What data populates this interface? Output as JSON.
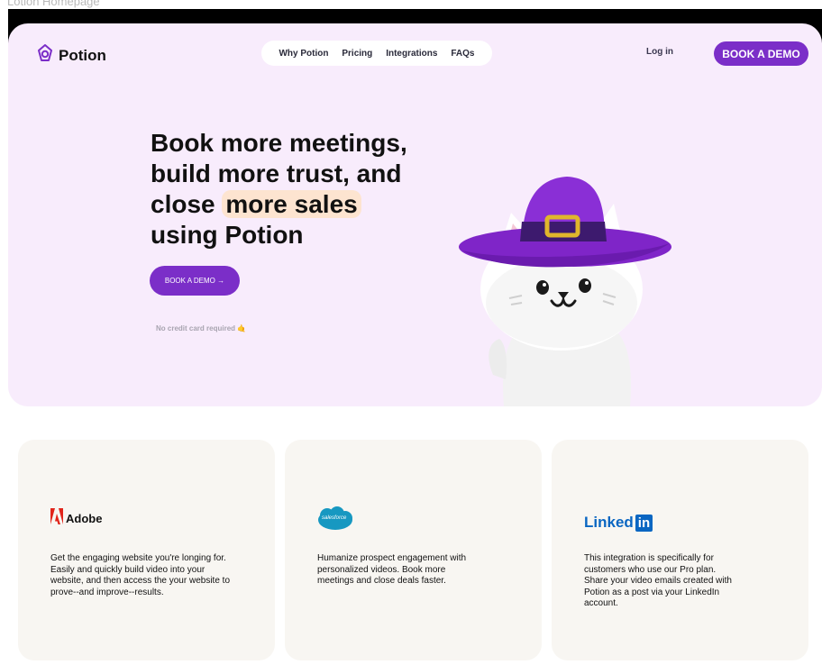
{
  "frame_label": "Lotion Homepage",
  "brand": {
    "name": "Potion",
    "accent": "#7b2ec8",
    "hero_bg": "#f8ecfc"
  },
  "nav": {
    "links": [
      "Why Potion",
      "Pricing",
      "Integrations",
      "FAQs"
    ],
    "login": "Log in",
    "demo": "BOOK A DEMO"
  },
  "hero": {
    "headline_line1": "Book more meetings,",
    "headline_line2": "build more trust, and",
    "headline_close": "close",
    "headline_highlight": "more sales",
    "headline_line4": "using Potion",
    "cta": "BOOK A DEMO →",
    "note": "No credit card required 🤙"
  },
  "integrations": [
    {
      "logo": "Adobe",
      "icon": "adobe-icon",
      "text": "Get the engaging website you're longing for. Easily and quickly build video into your website, and then access the your website to prove--and improve--results."
    },
    {
      "logo": "salesforce",
      "icon": "salesforce-icon",
      "text": "Humanize prospect engagement with personalized videos. Book more meetings and close deals faster."
    },
    {
      "logo": "Linked",
      "logo_suffix": "in",
      "icon": "linkedin-icon",
      "text": "This integration is specifically for customers who use our Pro plan. Share your video emails created with Potion as a post via your LinkedIn account."
    }
  ]
}
